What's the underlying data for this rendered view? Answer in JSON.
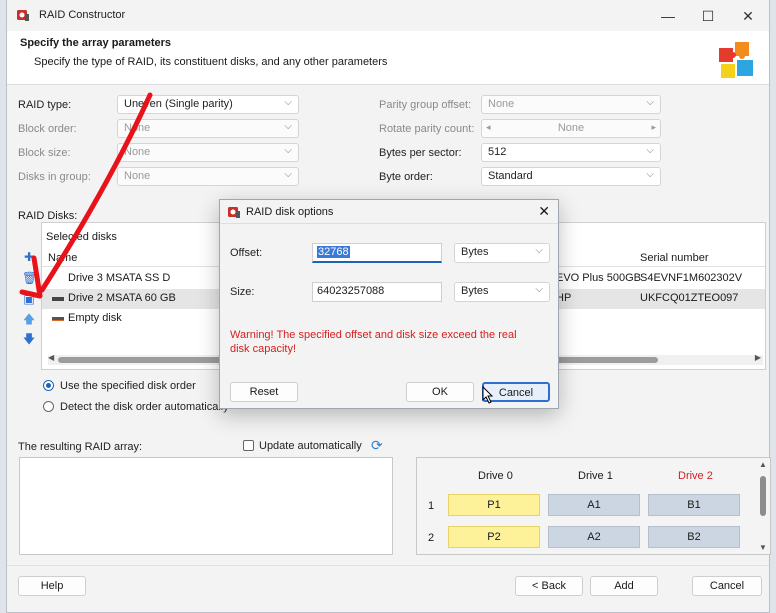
{
  "window": {
    "title": "RAID Constructor",
    "controls": {
      "minimize": "—",
      "maximize": "☐",
      "close": "✕"
    }
  },
  "header": {
    "title": "Specify the array parameters",
    "subtitle": "Specify the type of RAID, its constituent disks, and any other parameters"
  },
  "params": {
    "raid_type": {
      "label": "RAID type:",
      "value": "Uneven (Single parity)"
    },
    "block_order": {
      "label": "Block order:",
      "value": "None"
    },
    "block_size": {
      "label": "Block size:",
      "value": "None"
    },
    "disks_in_group": {
      "label": "Disks in group:",
      "value": "None"
    },
    "parity_group_offset": {
      "label": "Parity group offset:",
      "value": "None"
    },
    "rotate_parity_count": {
      "label": "Rotate parity count:",
      "value": "None"
    },
    "bytes_per_sector": {
      "label": "Bytes per sector:",
      "value": "512"
    },
    "byte_order": {
      "label": "Byte order:",
      "value": "Standard"
    }
  },
  "disks": {
    "label": "RAID Disks:",
    "selected_label": "Selected disks",
    "columns": {
      "name": "Name",
      "serial": "Serial number"
    },
    "rows": [
      {
        "name": "Drive 3 MSATA SS D",
        "model": "EVO Plus 500GB",
        "serial": "S4EVNF1M602302V"
      },
      {
        "name": "Drive 2 MSATA 60 GB",
        "model": "HP",
        "serial": "UKFCQ01ZTEO097"
      },
      {
        "name": "Empty disk",
        "model": "",
        "serial": ""
      }
    ]
  },
  "order_options": {
    "specified": "Use the specified disk order",
    "auto": "Detect the disk order automatically"
  },
  "result": {
    "label": "The resulting RAID array:",
    "update_auto": "Update automatically"
  },
  "raid_map": {
    "drives": [
      "Drive 0",
      "Drive 1",
      "Drive 2"
    ],
    "rows": [
      {
        "num": "1",
        "cells": [
          "P1",
          "A1",
          "B1"
        ]
      },
      {
        "num": "2",
        "cells": [
          "P2",
          "A2",
          "B2"
        ]
      }
    ],
    "missing_color": "#d42020"
  },
  "footer": {
    "help": "Help",
    "back": "< Back",
    "add": "Add",
    "cancel": "Cancel"
  },
  "dialog": {
    "title": "RAID disk options",
    "offset_label": "Offset:",
    "offset_value": "32768",
    "offset_unit": "Bytes",
    "size_label": "Size:",
    "size_value": "64023257088",
    "size_unit": "Bytes",
    "warning": "Warning! The specified offset and disk size exceed the real disk capacity!",
    "reset": "Reset",
    "ok": "OK",
    "cancel": "Cancel"
  }
}
